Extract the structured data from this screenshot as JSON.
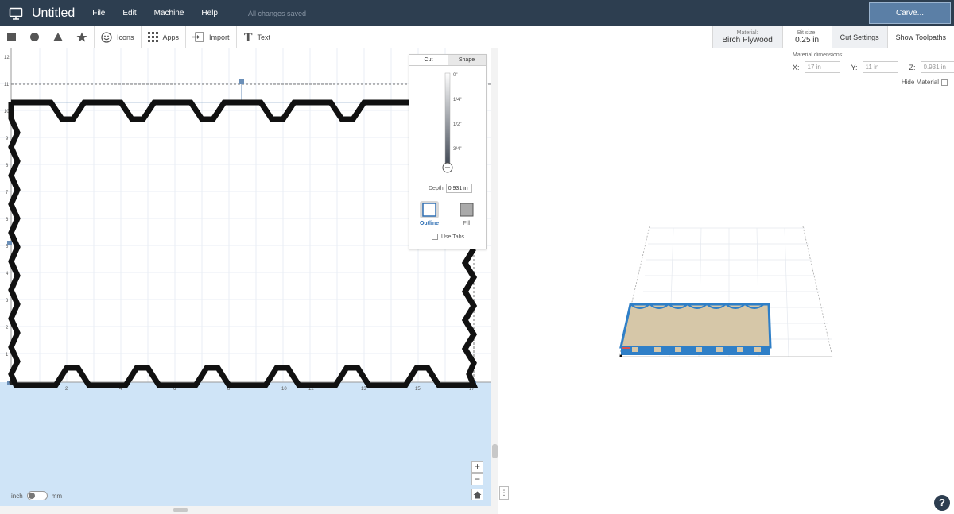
{
  "app": {
    "title": "Untitled",
    "save_status": "All changes saved",
    "carve_label": "Carve..."
  },
  "menu": [
    "File",
    "Edit",
    "Machine",
    "Help"
  ],
  "toolbar": {
    "icons_label": "Icons",
    "apps_label": "Apps",
    "import_label": "Import",
    "text_label": "Text",
    "material_caption": "Material:",
    "material_value": "Birch Plywood",
    "bit_caption": "Bit size:",
    "bit_value": "0.25 in",
    "cut_settings_label": "Cut Settings",
    "show_toolpaths_label": "Show Toolpaths"
  },
  "canvas": {
    "ruler_y": [
      "12",
      "11",
      "10",
      "9",
      "8",
      "7",
      "6",
      "5",
      "4",
      "3",
      "2",
      "1"
    ],
    "ruler_x": [
      "2",
      "4",
      "6",
      "8",
      "10",
      "12",
      "13",
      "15",
      "17"
    ],
    "units_left": "inch",
    "units_right": "mm",
    "zoom_in": "+",
    "zoom_out": "−",
    "home_icon": "home-icon"
  },
  "cut_panel": {
    "tab_cut": "Cut",
    "tab_shape": "Shape",
    "depth_ticks": [
      "0\"",
      "1/4\"",
      "1/2\"",
      "3/4\""
    ],
    "depth_label": "Depth",
    "depth_value": "0.931 in",
    "outline_label": "Outline",
    "fill_label": "Fill",
    "use_tabs_label": "Use Tabs"
  },
  "preview": {
    "dims_title": "Material dimensions:",
    "x_label": "X:",
    "x_value": "17 in",
    "y_label": "Y:",
    "y_value": "11 in",
    "z_label": "Z:",
    "z_value": "0.931 in",
    "hide_material_label": "Hide Material",
    "side_menu_glyph": "⋮",
    "help_glyph": "?"
  },
  "colors": {
    "topbar": "#2d3e50",
    "carve_button": "#5b7fa6",
    "workspace_blue": "#cfe4f7",
    "material_tan": "#d6c7a8",
    "toolpath_blue": "#2f7fc7"
  }
}
